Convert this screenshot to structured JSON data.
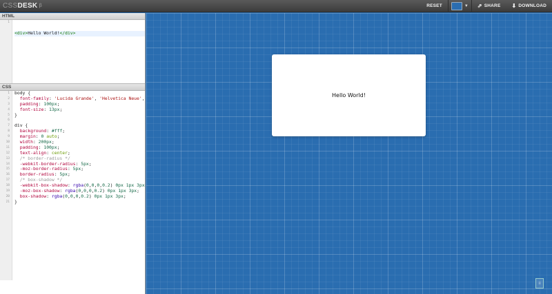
{
  "app": {
    "logo_prefix": "CSS",
    "logo_main": "DESK",
    "logo_suffix": "β"
  },
  "toolbar": {
    "reset": "RESET",
    "share": "SHARE",
    "download": "DOWNLOAD",
    "share_icon": "share-icon",
    "download_icon": "download-icon",
    "background_color": "#2a6db0"
  },
  "html_panel": {
    "title": "HTML",
    "lines": [
      "<div>Hello World!</div>"
    ]
  },
  "css_panel": {
    "title": "CSS",
    "lines": [
      "body {",
      "  font-family: 'Lucida Grande', 'Helvetica Neue', He",
      "  padding: 100px;",
      "  font-size: 13px;",
      "}",
      "",
      "div {",
      "  background: #fff;",
      "  margin: 0 auto;",
      "  width: 200px;",
      "  padding: 100px;",
      "  text-align: center;",
      "  /* border-radius */",
      "  -webkit-border-radius: 5px;",
      "  -moz-border-radius: 5px;",
      "  border-radius: 5px;",
      "  /* box-shadow */",
      "  -webkit-box-shadow: rgba(0,0,0,0.2) 0px 1px 3px;",
      "  -moz-box-shadow: rgba(0,0,0,0.2) 0px 1px 3px;",
      "  box-shadow: rgba(0,0,0,0.2) 0px 1px 3px;",
      "}"
    ]
  },
  "preview": {
    "text": "Hello World!"
  }
}
